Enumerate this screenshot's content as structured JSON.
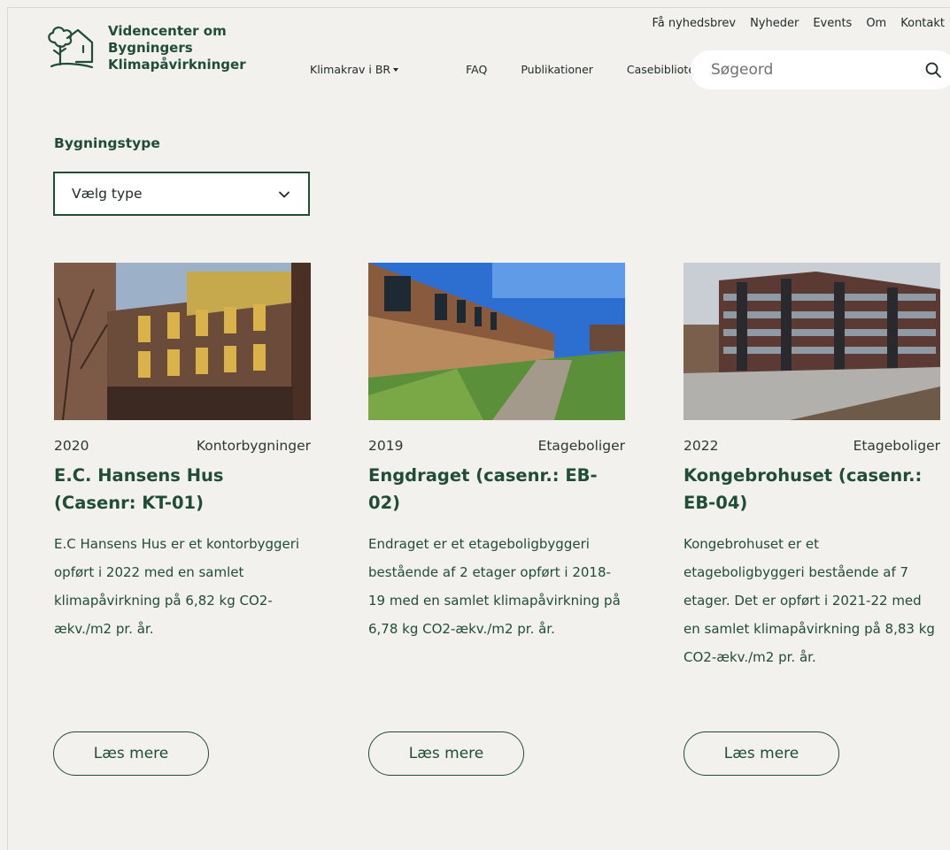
{
  "logo": {
    "line1": "Videncenter om",
    "line2": "Bygningers",
    "line3": "Klimapåvirkninger"
  },
  "topnav": [
    "Få nyhedsbrev",
    "Nyheder",
    "Events",
    "Om",
    "Kontakt"
  ],
  "mainnav": [
    "Klimakrav i BR",
    "FAQ",
    "Publikationer",
    "Casebibliotek"
  ],
  "search": {
    "placeholder": "Søgeord"
  },
  "filter": {
    "label": "Bygningstype",
    "selected": "Vælg type"
  },
  "cards": [
    {
      "year": "2020",
      "type": "Kontorbygninger",
      "title": "E.C. Hansens Hus (Casenr: KT-01)",
      "description": "E.C Hansens Hus er et kontorbyggeri opført i 2022 med en samlet klimapåvirkning på 6,82 kg CO2-ækv./m2 pr. år.",
      "button": "Læs mere"
    },
    {
      "year": "2019",
      "type": "Etageboliger",
      "title": "Engdraget (casenr.: EB-02)",
      "description": "Endraget er et etageboligbyggeri bestående af 2 etager opført i 2018-19 med en samlet klimapåvirkning på 6,78 kg CO2-ækv./m2 pr. år.",
      "button": "Læs mere"
    },
    {
      "year": "2022",
      "type": "Etageboliger",
      "title": "Kongebrohuset (casenr.: EB-04)",
      "description": "Kongebrohuset er et etageboligbyggeri bestående af 7 etager. Det er opført i 2021-22 med en samlet klimapåvirkning på 8,83 kg CO2-ækv./m2 pr. år.",
      "button": "Læs mere"
    }
  ],
  "colors": {
    "brand": "#1f4d35",
    "background": "#f3f1ee"
  }
}
